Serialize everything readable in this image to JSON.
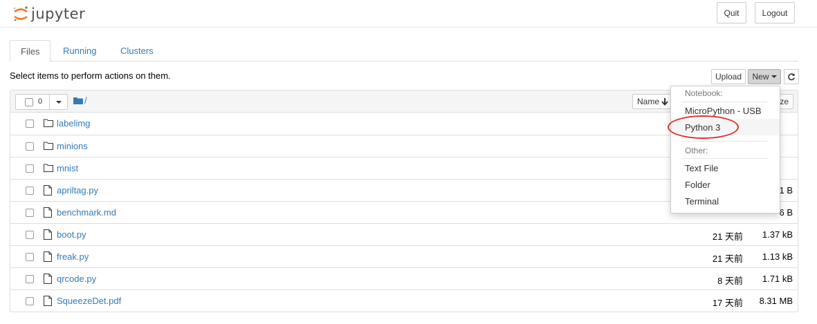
{
  "header": {
    "logo_text": "jupyter",
    "quit_label": "Quit",
    "logout_label": "Logout"
  },
  "tabs": [
    {
      "label": "Files",
      "active": true
    },
    {
      "label": "Running",
      "active": false
    },
    {
      "label": "Clusters",
      "active": false
    }
  ],
  "toolbar": {
    "hint": "Select items to perform actions on them.",
    "upload_label": "Upload",
    "new_label": "New",
    "refresh_icon": "refresh-icon"
  },
  "list_header": {
    "selected_count": "0",
    "path": "/",
    "sort_name_label": "Name",
    "size_label": "ze"
  },
  "files": [
    {
      "name": "labelimg",
      "type": "folder",
      "modified": "",
      "size": ""
    },
    {
      "name": "minions",
      "type": "folder",
      "modified": "",
      "size": ""
    },
    {
      "name": "mnist",
      "type": "folder",
      "modified": "",
      "size": ""
    },
    {
      "name": "apriltag.py",
      "type": "file",
      "modified": "",
      "size": "1 B"
    },
    {
      "name": "benchmark.md",
      "type": "file",
      "modified": "",
      "size": "6 B"
    },
    {
      "name": "boot.py",
      "type": "file",
      "modified": "21 天前",
      "size": "1.37 kB"
    },
    {
      "name": "freak.py",
      "type": "file",
      "modified": "21 天前",
      "size": "1.13 kB"
    },
    {
      "name": "qrcode.py",
      "type": "file",
      "modified": "8 天前",
      "size": "1.71 kB"
    },
    {
      "name": "SqueezeDet.pdf",
      "type": "file",
      "modified": "17 天前",
      "size": "8.31 MB"
    }
  ],
  "new_menu": {
    "notebook_header": "Notebook:",
    "notebook_items": [
      "MicroPython - USB",
      "Python 3"
    ],
    "other_header": "Other:",
    "other_items": [
      "Text File",
      "Folder",
      "Terminal"
    ]
  },
  "colors": {
    "link": "#337ab7",
    "logo_orange": "#f37726",
    "annotation_ring": "#e03030"
  }
}
